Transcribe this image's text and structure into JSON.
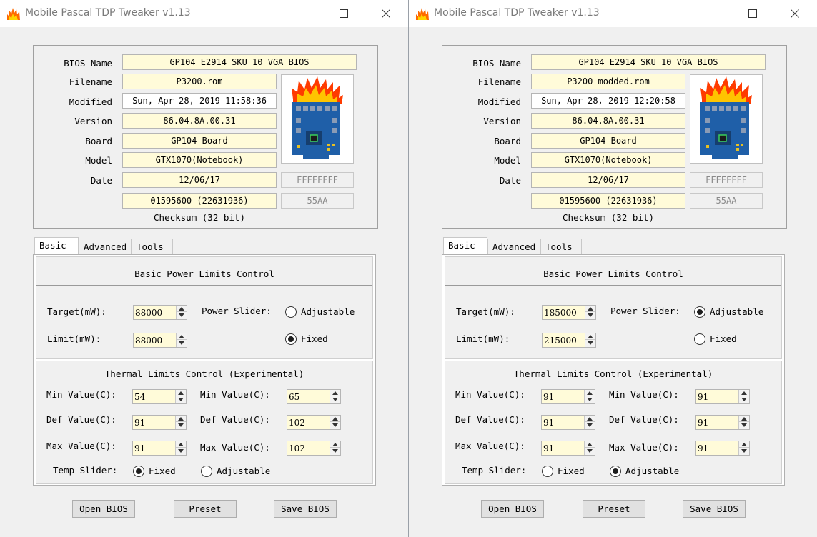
{
  "windows": [
    {
      "title": "Mobile Pascal TDP Tweaker v1.13",
      "labels": {
        "bios_name": "BIOS Name",
        "filename": "Filename",
        "modified": "Modified",
        "version": "Version",
        "board": "Board",
        "model": "Model",
        "date": "Date",
        "checksum": "Checksum (32 bit)"
      },
      "info": {
        "bios_name": "GP104 E2914 SKU 10 VGA BIOS",
        "filename": "P3200.rom",
        "modified": "Sun, Apr 28, 2019 11:58:36",
        "version": "86.04.8A.00.31",
        "board": "GP104 Board",
        "model": "GTX1070(Notebook)",
        "date": "12/06/17",
        "date_hex": "FFFFFFFF",
        "checksum": "01595600 (22631936)",
        "signature": "55AA"
      },
      "tabs": [
        "Basic",
        "Advanced",
        "Tools"
      ],
      "active_tab": "Basic",
      "power": {
        "title": "Basic Power Limits Control",
        "target_label": "Target(mW):",
        "target_value": "88000",
        "limit_label": "Limit(mW):",
        "limit_value": "88000",
        "slider_label": "Power Slider:",
        "adjustable_label": "Adjustable",
        "fixed_label": "Fixed",
        "slider_selected": "Fixed"
      },
      "thermal": {
        "title": "Thermal Limits Control (Experimental)",
        "min_label": "Min Value(C):",
        "def_label": "Def Value(C):",
        "max_label": "Max Value(C):",
        "left": {
          "min": "54",
          "def": "91",
          "max": "91"
        },
        "right": {
          "min": "65",
          "def": "102",
          "max": "102"
        },
        "temp_slider_label": "Temp Slider:",
        "fixed_label": "Fixed",
        "adjustable_label": "Adjustable",
        "temp_selected": "Fixed"
      },
      "buttons": {
        "open": "Open BIOS",
        "preset": "Preset",
        "save": "Save BIOS"
      }
    },
    {
      "title": "Mobile Pascal TDP Tweaker v1.13",
      "labels": {
        "bios_name": "BIOS Name",
        "filename": "Filename",
        "modified": "Modified",
        "version": "Version",
        "board": "Board",
        "model": "Model",
        "date": "Date",
        "checksum": "Checksum (32 bit)"
      },
      "info": {
        "bios_name": "GP104 E2914 SKU 10 VGA BIOS",
        "filename": "P3200_modded.rom",
        "modified": "Sun, Apr 28, 2019 12:20:58",
        "version": "86.04.8A.00.31",
        "board": "GP104 Board",
        "model": "GTX1070(Notebook)",
        "date": "12/06/17",
        "date_hex": "FFFFFFFF",
        "checksum": "01595600 (22631936)",
        "signature": "55AA"
      },
      "tabs": [
        "Basic",
        "Advanced",
        "Tools"
      ],
      "active_tab": "Basic",
      "power": {
        "title": "Basic Power Limits Control",
        "target_label": "Target(mW):",
        "target_value": "185000",
        "limit_label": "Limit(mW):",
        "limit_value": "215000",
        "slider_label": "Power Slider:",
        "adjustable_label": "Adjustable",
        "fixed_label": "Fixed",
        "slider_selected": "Adjustable"
      },
      "thermal": {
        "title": "Thermal Limits Control (Experimental)",
        "min_label": "Min Value(C):",
        "def_label": "Def Value(C):",
        "max_label": "Max Value(C):",
        "left": {
          "min": "91",
          "def": "91",
          "max": "91"
        },
        "right": {
          "min": "91",
          "def": "91",
          "max": "91"
        },
        "temp_slider_label": "Temp Slider:",
        "fixed_label": "Fixed",
        "adjustable_label": "Adjustable",
        "temp_selected": "Adjustable"
      },
      "buttons": {
        "open": "Open BIOS",
        "preset": "Preset",
        "save": "Save BIOS"
      }
    }
  ],
  "icons": {
    "app": "flame-icon",
    "gpu_image": "flaming-gpu-board-icon",
    "minimize": "minimize-icon",
    "maximize": "maximize-icon",
    "close": "close-icon"
  },
  "colors": {
    "field_bg": "#fffbd9",
    "window_bg": "#f0f0f0",
    "title_text": "#7a7a7a",
    "flame_orange": "#ff6a00",
    "board_blue": "#1f5fa8"
  }
}
